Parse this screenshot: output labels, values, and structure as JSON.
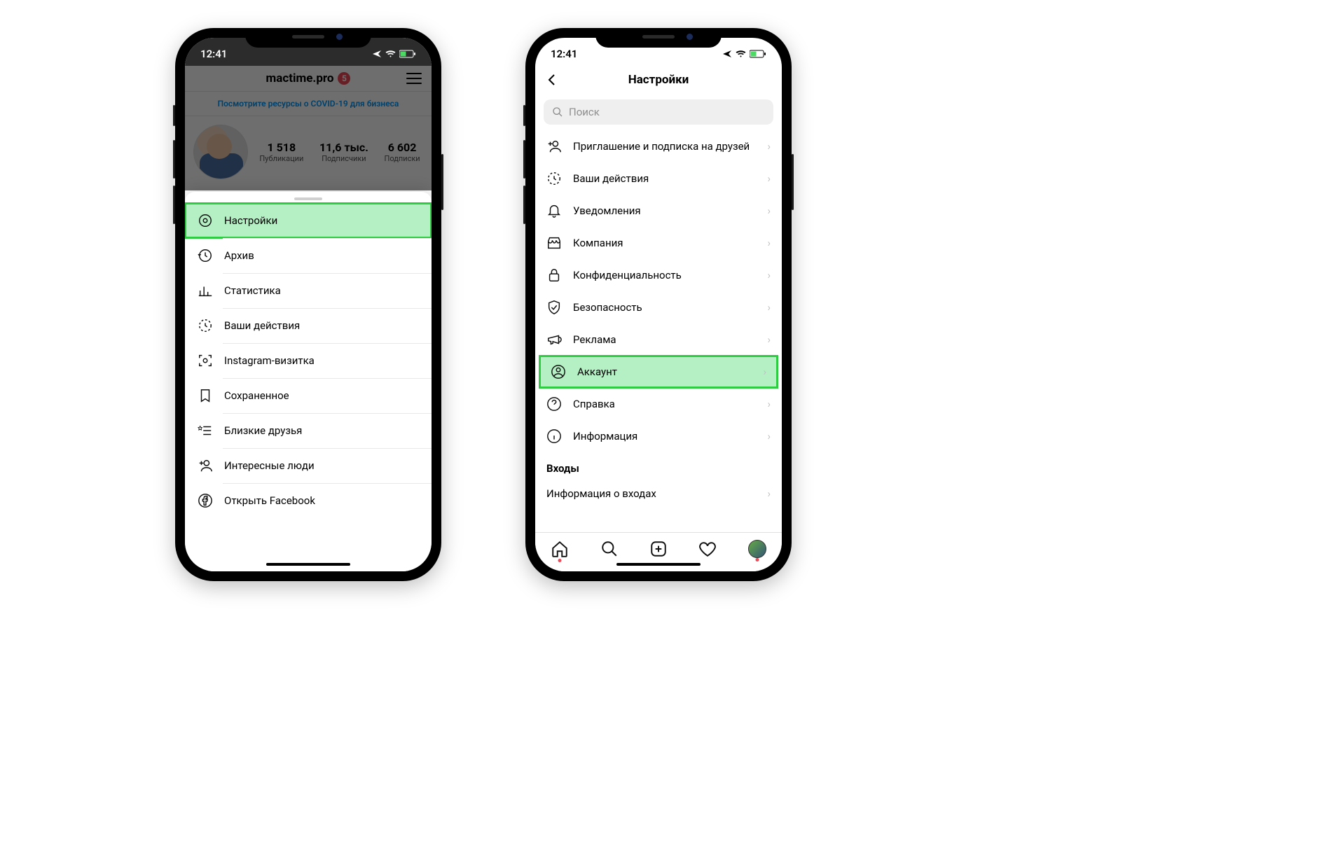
{
  "status": {
    "time": "12:41"
  },
  "phone1": {
    "username": "mactime.pro",
    "badge": "5",
    "covid_banner": "Посмотрите ресурсы о COVID-19 для бизнеса",
    "stats": {
      "posts": {
        "num": "1 518",
        "label": "Публикации"
      },
      "followers": {
        "num": "11,6 тыс.",
        "label": "Подписчики"
      },
      "following": {
        "num": "6 602",
        "label": "Подписки"
      }
    },
    "menu": [
      {
        "label": "Настройки"
      },
      {
        "label": "Архив"
      },
      {
        "label": "Статистика"
      },
      {
        "label": "Ваши действия"
      },
      {
        "label": "Instagram-визитка"
      },
      {
        "label": "Сохраненное"
      },
      {
        "label": "Близкие друзья"
      },
      {
        "label": "Интересные люди"
      },
      {
        "label": "Открыть Facebook"
      }
    ]
  },
  "phone2": {
    "title": "Настройки",
    "search_placeholder": "Поиск",
    "items": [
      {
        "label": "Приглашение и подписка на друзей"
      },
      {
        "label": "Ваши действия"
      },
      {
        "label": "Уведомления"
      },
      {
        "label": "Компания"
      },
      {
        "label": "Конфиденциальность"
      },
      {
        "label": "Безопасность"
      },
      {
        "label": "Реклама"
      },
      {
        "label": "Аккаунт"
      },
      {
        "label": "Справка"
      },
      {
        "label": "Информация"
      }
    ],
    "logins_header": "Входы",
    "logins_info": "Информация о входах"
  }
}
